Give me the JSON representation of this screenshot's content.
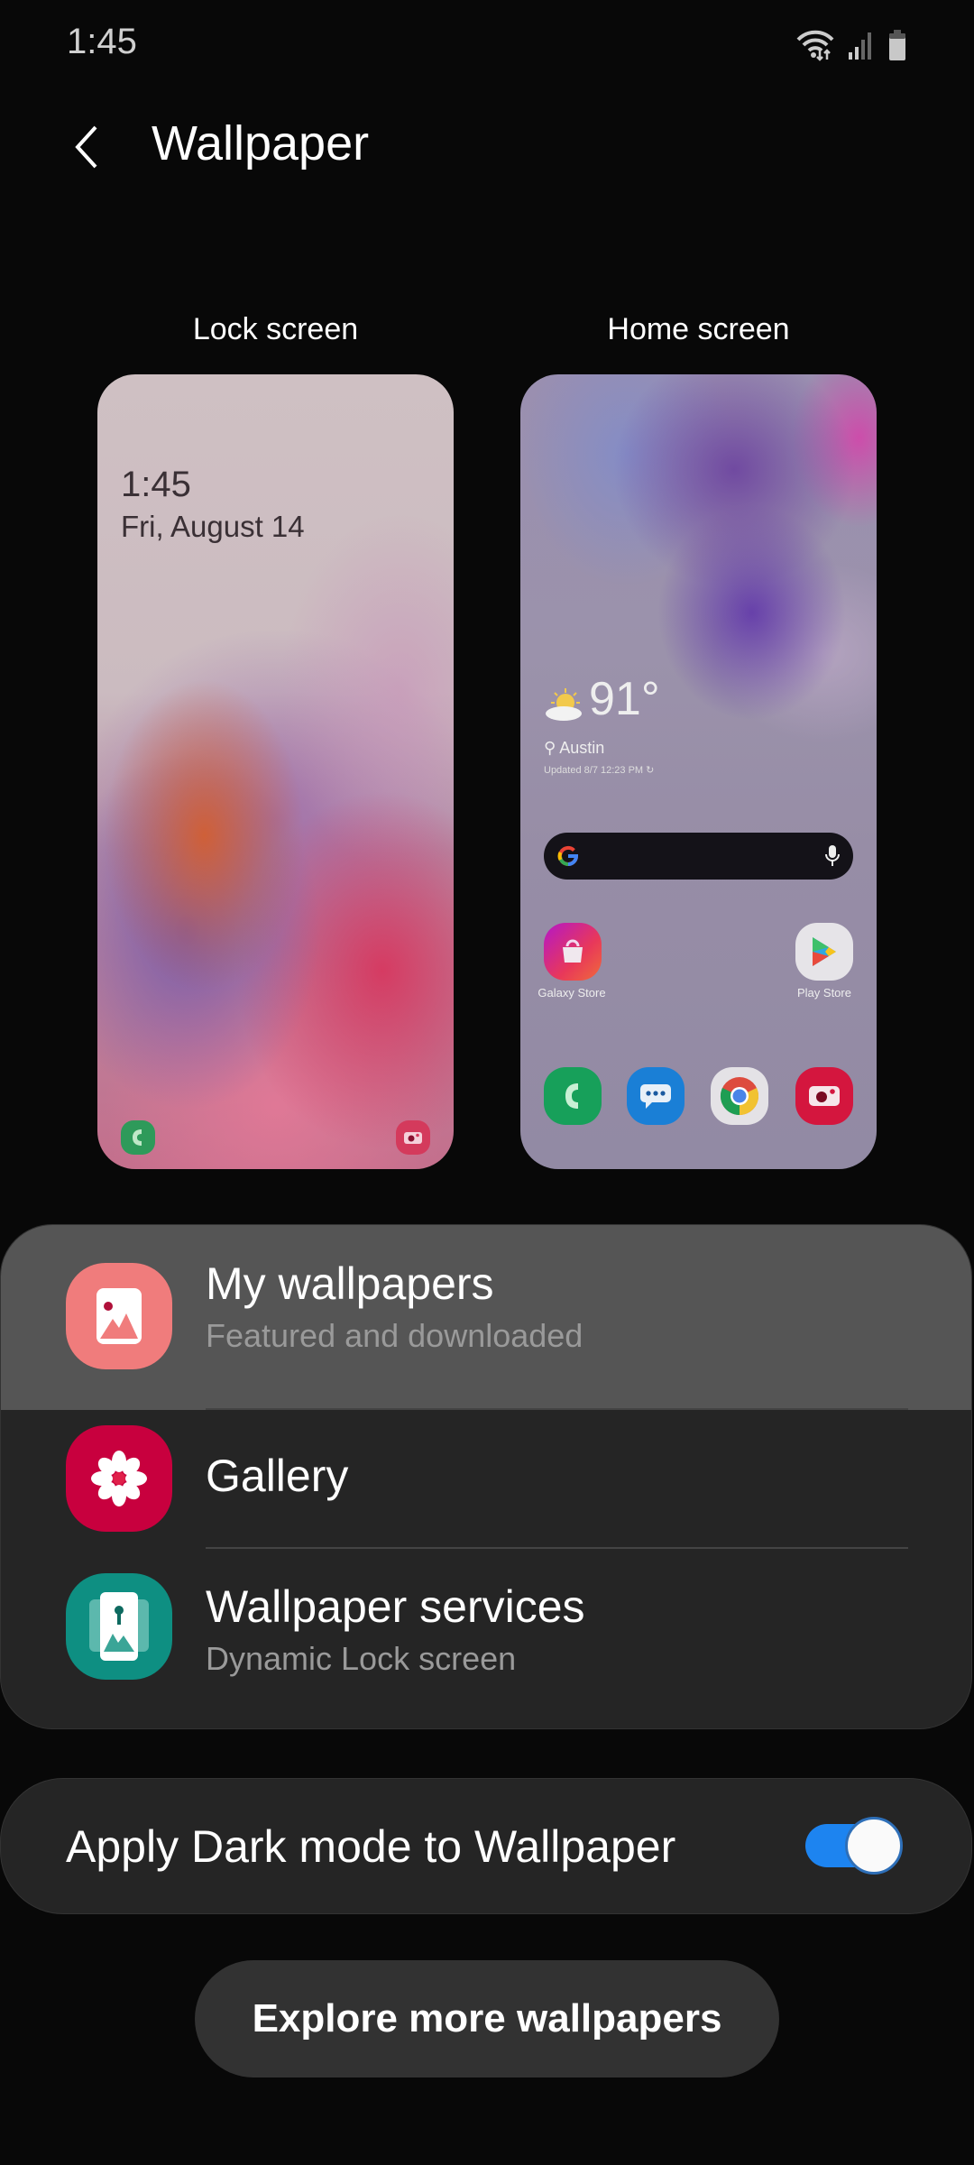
{
  "status_bar": {
    "time": "1:45",
    "icons": [
      "wifi-icon",
      "signal-icon",
      "battery-icon"
    ]
  },
  "header": {
    "back_icon": "chevron-left-icon",
    "title": "Wallpaper"
  },
  "previews": {
    "lock": {
      "label": "Lock screen",
      "time": "1:45",
      "date": "Fri, August 14",
      "shortcuts": [
        "phone-icon",
        "camera-icon"
      ]
    },
    "home": {
      "label": "Home screen",
      "weather": {
        "temp": "91°",
        "location": "Austin",
        "updated": "Updated 8/7 12:23 PM"
      },
      "apps": [
        {
          "label": "Galaxy Store",
          "icon": "galaxy-store-icon"
        },
        {
          "label": "Play Store",
          "icon": "play-store-icon"
        }
      ],
      "dock": [
        "phone-icon",
        "messages-icon",
        "chrome-icon",
        "camera-icon"
      ]
    }
  },
  "options": [
    {
      "title": "My wallpapers",
      "subtitle": "Featured and downloaded",
      "icon": "image-icon",
      "color": "#f07c7c",
      "highlighted": true
    },
    {
      "title": "Gallery",
      "subtitle": "",
      "icon": "flower-icon",
      "color": "#c8003e"
    },
    {
      "title": "Wallpaper services",
      "subtitle": "Dynamic Lock screen",
      "icon": "wallpaper-services-icon",
      "color": "#0e8f82"
    }
  ],
  "dark_mode_toggle": {
    "label": "Apply Dark mode to Wallpaper",
    "checked": true,
    "accent": "#1d84f0"
  },
  "explore_button": {
    "label": "Explore more wallpapers"
  }
}
